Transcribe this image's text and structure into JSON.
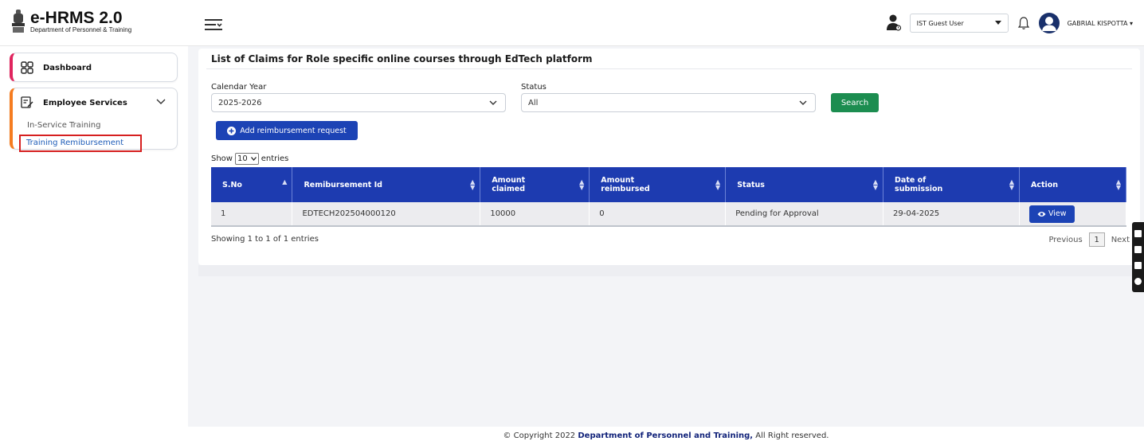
{
  "header": {
    "logo_title": "e-HRMS 2.0",
    "logo_subtitle": "Department of Personnel & Training",
    "role_selected": "IST Guest User",
    "user_name": "GABRIAL KISPOTTA ▾"
  },
  "sidebar": {
    "items": [
      {
        "label": "Dashboard",
        "icon": "dashboard-icon",
        "accent": "#e0245e"
      },
      {
        "label": "Employee Services",
        "icon": "edit-document-icon",
        "accent": "#f57c20"
      }
    ],
    "sub_items": [
      {
        "label": "In-Service Training"
      },
      {
        "label": "Training Remibursement"
      }
    ]
  },
  "main": {
    "title": "List of Claims for Role specific online courses through EdTech platform",
    "calendar_year_label": "Calendar Year",
    "calendar_year_value": "2025-2026",
    "status_label": "Status",
    "status_value": "All",
    "search_label": "Search",
    "add_label": "Add reimbursement request",
    "show_label": "Show",
    "show_value": "10",
    "entries_label": "entries",
    "table": {
      "headers": [
        "S.No",
        "Remibursement Id",
        "Amount claimed",
        "Amount reimbursed",
        "Status",
        "Date of submission",
        "Action"
      ],
      "rows": [
        {
          "sno": "1",
          "id": "EDTECH202504000120",
          "claimed": "10000",
          "reimbursed": "0",
          "status": "Pending for Approval",
          "date": "29-04-2025",
          "action": "View"
        }
      ]
    },
    "info_text": "Showing 1 to 1 of 1 entries",
    "pager": {
      "previous": "Previous",
      "page": "1",
      "next": "Next"
    }
  },
  "footer": {
    "prefix": "© Copyright 2022 ",
    "org": "Department of Personnel and Training,",
    "suffix": " All Right reserved."
  },
  "colors": {
    "table_header": "#1d3bb0",
    "primary_button": "#1c43b5",
    "search_button": "#1c8d50",
    "active_highlight": "#d62020"
  }
}
